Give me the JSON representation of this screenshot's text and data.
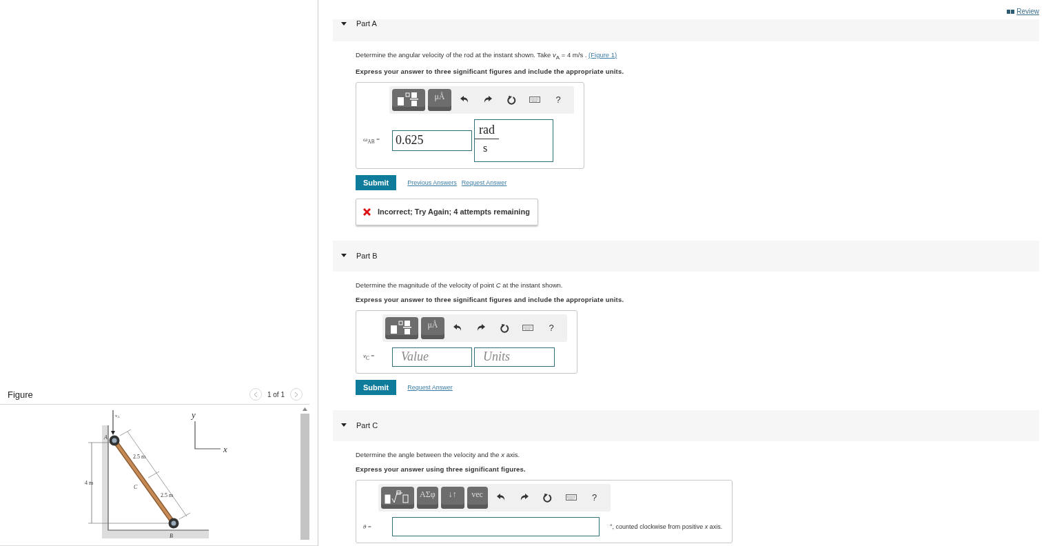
{
  "review_link": "Review",
  "figure_panel": {
    "title": "Figure",
    "pager": "1 of 1",
    "labels": {
      "velocity": "v",
      "velocity_sub": "A",
      "point_a": "A",
      "point_b": "B",
      "point_c": "C",
      "height": "4 m",
      "upper_length": "2.5 m",
      "lower_length": "2.5 m",
      "axis_x": "x",
      "axis_y": "y"
    }
  },
  "parts": [
    {
      "title": "Part A",
      "expanded": true,
      "question": "Determine the angular velocity of the rod at the instant shown. Take *v*$_{A}$ = 4 m/s .",
      "figure_link": "(Figure 1)",
      "instruction": "Express your answer to three significant figures and include the appropriate units.",
      "toolbar": [
        {
          "kind": "template"
        },
        {
          "kind": "symbol",
          "label": "μÅ"
        },
        {
          "kind": "undo"
        },
        {
          "kind": "redo"
        },
        {
          "kind": "reset"
        },
        {
          "kind": "keyboard"
        },
        {
          "kind": "help",
          "label": "?"
        }
      ],
      "answer": {
        "kind": "value_units",
        "label": "*ω*$_{AB}$ =",
        "value": "0.625",
        "units_numerator": "rad",
        "units_denominator": "s"
      },
      "actions": [
        {
          "kind": "submit",
          "label": "Submit"
        },
        {
          "kind": "link",
          "label": "Previous Answers"
        },
        {
          "kind": "link",
          "label": "Request Answer"
        }
      ],
      "feedback": "Incorrect; Try Again; 4 attempts remaining"
    },
    {
      "title": "Part B",
      "expanded": true,
      "question": "Determine the magnitude of the velocity of point *C* at the instant shown.",
      "instruction": "Express your answer to three significant figures and include the appropriate units.",
      "toolbar": [
        {
          "kind": "template"
        },
        {
          "kind": "symbol",
          "label": "μÅ"
        },
        {
          "kind": "undo"
        },
        {
          "kind": "redo"
        },
        {
          "kind": "reset"
        },
        {
          "kind": "keyboard"
        },
        {
          "kind": "help",
          "label": "?"
        }
      ],
      "answer": {
        "kind": "value_units_empty",
        "label": "*v*$_{C}$ =",
        "value_placeholder": "Value",
        "units_placeholder": "Units"
      },
      "actions": [
        {
          "kind": "submit",
          "label": "Submit"
        },
        {
          "kind": "link",
          "label": "Request Answer"
        }
      ]
    },
    {
      "title": "Part C",
      "expanded": true,
      "question": "Determine the angle between the velocity and the *x* axis.",
      "instruction": "Express your answer using three significant figures.",
      "toolbar": [
        {
          "kind": "radical"
        },
        {
          "kind": "symbol",
          "label": "ΑΣφ"
        },
        {
          "kind": "symbol",
          "label": "↓↑"
        },
        {
          "kind": "symbol",
          "label": "vec"
        },
        {
          "kind": "undo"
        },
        {
          "kind": "redo"
        },
        {
          "kind": "reset"
        },
        {
          "kind": "keyboard"
        },
        {
          "kind": "help",
          "label": "?"
        }
      ],
      "answer": {
        "kind": "single",
        "label": "*θ* =",
        "suffix": "°, counted clockwise from positive *x* axis."
      }
    }
  ]
}
